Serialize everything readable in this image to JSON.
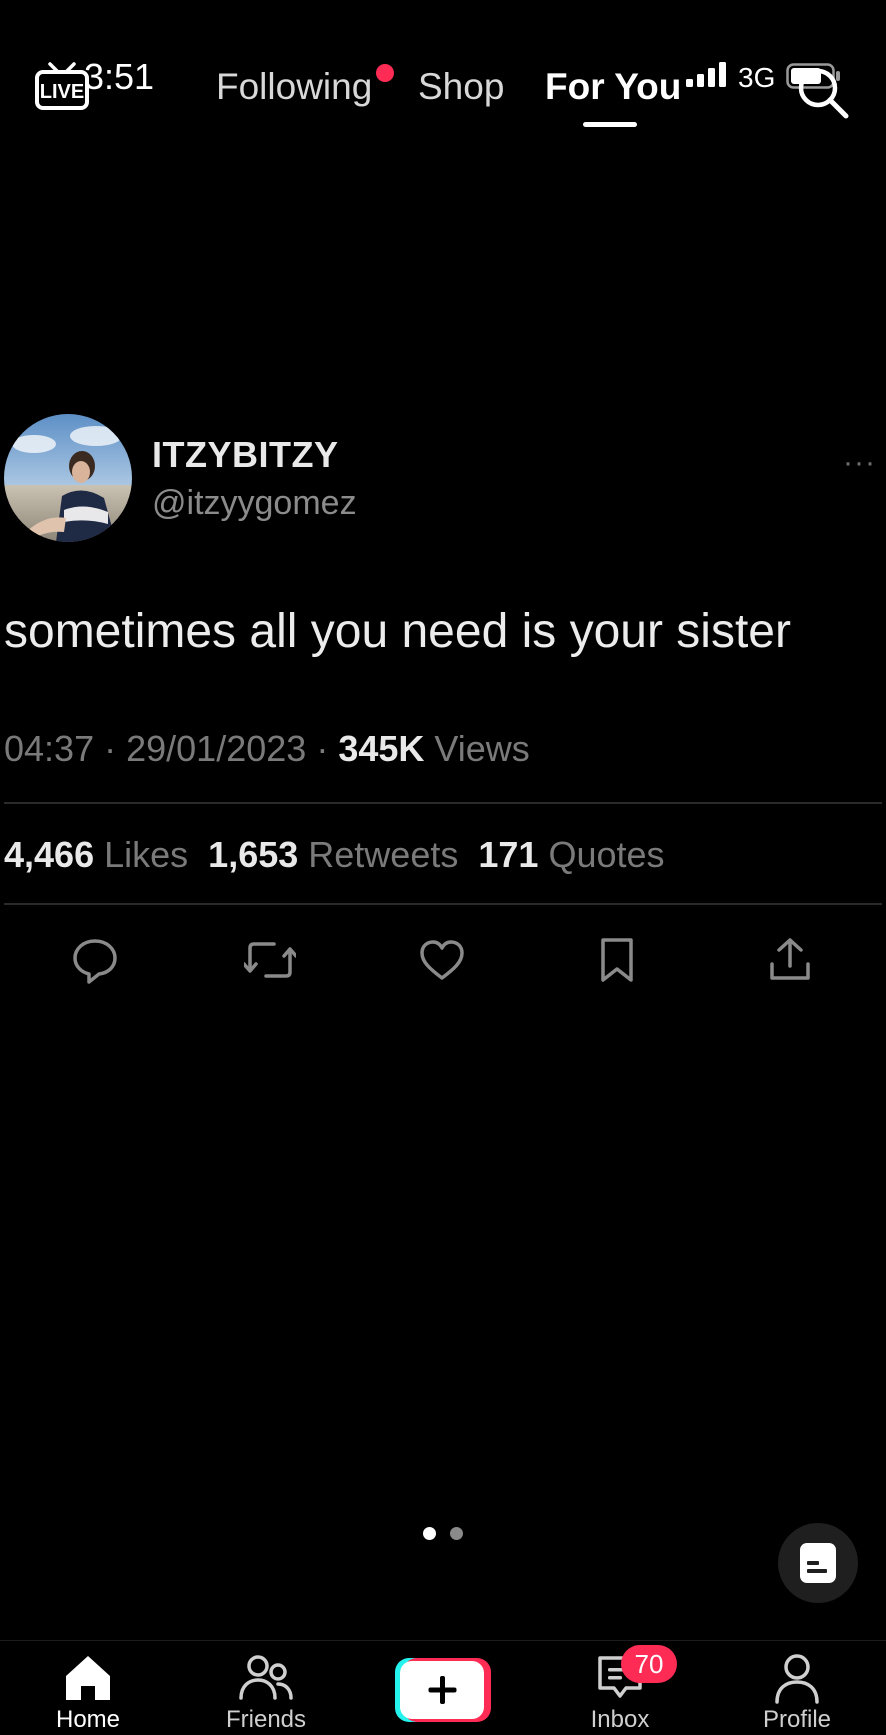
{
  "status_bar": {
    "time": "3:51",
    "network": "3G",
    "icons": [
      "signal-icon",
      "battery-icon"
    ]
  },
  "top_nav": {
    "live_label": "LIVE",
    "tabs": [
      {
        "label": "Following",
        "has_dot": true
      },
      {
        "label": "Shop"
      },
      {
        "label": "For You",
        "active": true
      }
    ],
    "search_icon": "search-icon"
  },
  "tweet": {
    "display_name": "ITZYBITZY",
    "handle": "@itzyygomez",
    "more": "···",
    "text": "sometimes all you need is your sister",
    "time": "04:37",
    "date": "29/01/2023",
    "views_count": "345K",
    "views_label": "Views",
    "likes_count": "4,466",
    "likes_label": "Likes",
    "retweets_count": "1,653",
    "retweets_label": "Retweets",
    "quotes_count": "171",
    "quotes_label": "Quotes",
    "actions": [
      "reply-icon",
      "retweet-icon",
      "like-icon",
      "bookmark-icon",
      "share-icon"
    ]
  },
  "carousel": {
    "pages": 2,
    "active_page": 1
  },
  "bottom_nav": {
    "items": [
      {
        "label": "Home",
        "icon": "home-icon",
        "active": true
      },
      {
        "label": "Friends",
        "icon": "friends-icon"
      },
      {
        "label": "",
        "icon": "create-icon"
      },
      {
        "label": "Inbox",
        "icon": "inbox-icon",
        "badge": "70"
      },
      {
        "label": "Profile",
        "icon": "profile-icon"
      }
    ]
  },
  "colors": {
    "background": "#000000",
    "accent": "#fe2c55",
    "cyan": "#25f4ee"
  }
}
